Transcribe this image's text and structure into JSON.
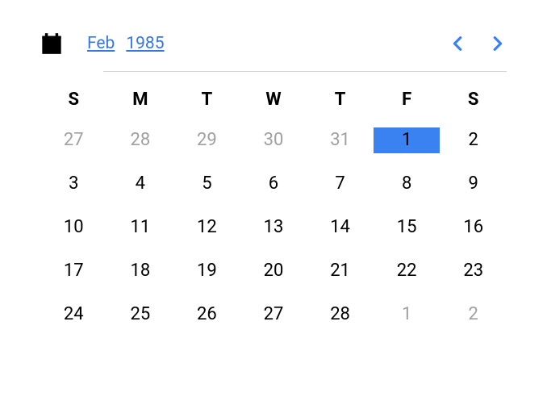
{
  "header": {
    "month": "Feb",
    "year": "1985"
  },
  "weekdays": [
    "S",
    "M",
    "T",
    "W",
    "T",
    "F",
    "S"
  ],
  "days": [
    {
      "num": "27",
      "outside": true,
      "selected": false
    },
    {
      "num": "28",
      "outside": true,
      "selected": false
    },
    {
      "num": "29",
      "outside": true,
      "selected": false
    },
    {
      "num": "30",
      "outside": true,
      "selected": false
    },
    {
      "num": "31",
      "outside": true,
      "selected": false
    },
    {
      "num": "1",
      "outside": false,
      "selected": true
    },
    {
      "num": "2",
      "outside": false,
      "selected": false
    },
    {
      "num": "3",
      "outside": false,
      "selected": false
    },
    {
      "num": "4",
      "outside": false,
      "selected": false
    },
    {
      "num": "5",
      "outside": false,
      "selected": false
    },
    {
      "num": "6",
      "outside": false,
      "selected": false
    },
    {
      "num": "7",
      "outside": false,
      "selected": false
    },
    {
      "num": "8",
      "outside": false,
      "selected": false
    },
    {
      "num": "9",
      "outside": false,
      "selected": false
    },
    {
      "num": "10",
      "outside": false,
      "selected": false
    },
    {
      "num": "11",
      "outside": false,
      "selected": false
    },
    {
      "num": "12",
      "outside": false,
      "selected": false
    },
    {
      "num": "13",
      "outside": false,
      "selected": false
    },
    {
      "num": "14",
      "outside": false,
      "selected": false
    },
    {
      "num": "15",
      "outside": false,
      "selected": false
    },
    {
      "num": "16",
      "outside": false,
      "selected": false
    },
    {
      "num": "17",
      "outside": false,
      "selected": false
    },
    {
      "num": "18",
      "outside": false,
      "selected": false
    },
    {
      "num": "19",
      "outside": false,
      "selected": false
    },
    {
      "num": "20",
      "outside": false,
      "selected": false
    },
    {
      "num": "21",
      "outside": false,
      "selected": false
    },
    {
      "num": "22",
      "outside": false,
      "selected": false
    },
    {
      "num": "23",
      "outside": false,
      "selected": false
    },
    {
      "num": "24",
      "outside": false,
      "selected": false
    },
    {
      "num": "25",
      "outside": false,
      "selected": false
    },
    {
      "num": "26",
      "outside": false,
      "selected": false
    },
    {
      "num": "27",
      "outside": false,
      "selected": false
    },
    {
      "num": "28",
      "outside": false,
      "selected": false
    },
    {
      "num": "1",
      "outside": true,
      "selected": false
    },
    {
      "num": "2",
      "outside": true,
      "selected": false
    }
  ]
}
